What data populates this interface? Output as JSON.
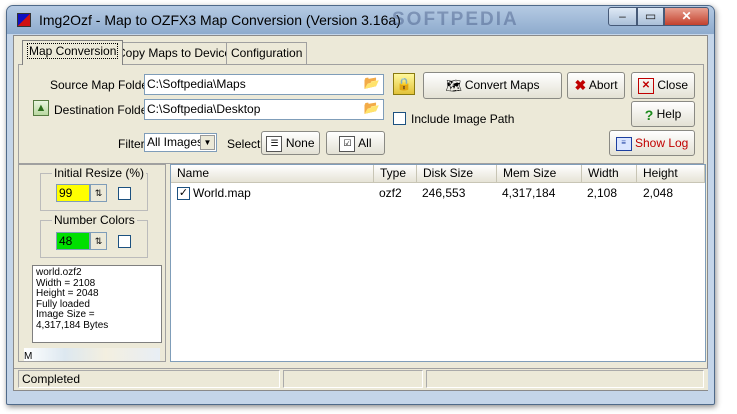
{
  "window": {
    "title": "Img2Ozf - Map to OZFX3 Map Conversion (Version 3.16a)",
    "watermark": "SOFTPEDIA",
    "minimize_label": "‒",
    "maximize_label": "▭",
    "close_label": "✕"
  },
  "tabs": [
    {
      "label": "Map Conversion"
    },
    {
      "label": "Copy Maps to Device"
    },
    {
      "label": "Configuration"
    }
  ],
  "source": {
    "label": "Source Map Folder",
    "value": "C:\\Softpedia\\Maps"
  },
  "destination": {
    "label": "Destination Folder",
    "value": "C:\\Softpedia\\Desktop"
  },
  "filter": {
    "label": "Filter",
    "value": "All Images"
  },
  "select": {
    "label": "Select",
    "none_label": "None",
    "all_label": "All"
  },
  "buttons": {
    "convert": "Convert Maps",
    "abort": "Abort",
    "close": "Close",
    "help": "Help",
    "show_log": "Show Log"
  },
  "include_image_path": {
    "label": "Include Image Path",
    "checked": false
  },
  "initial_resize": {
    "label": "Initial Resize (%)",
    "value": "99",
    "color": "#ffff00"
  },
  "number_colors": {
    "label": "Number Colors",
    "value": "48",
    "color": "#00e000"
  },
  "info_lines": [
    "world.ozf2",
    "Width = 2108",
    "Height = 2048",
    "Fully loaded",
    "Image Size =",
    "4,317,184 Bytes"
  ],
  "map_label": "M",
  "list": {
    "columns": [
      "Name",
      "Type",
      "Disk Size",
      "Mem Size",
      "Width",
      "Height"
    ],
    "rows": [
      {
        "name": "World.map",
        "checked": true,
        "type": "ozf2",
        "disk_size": "246,553",
        "mem_size": "4,317,184",
        "width": "2,108",
        "height": "2,048"
      }
    ]
  },
  "status": {
    "text": "Completed"
  },
  "colors": {
    "show_log_text": "#c00000",
    "accent": "#316ac5"
  }
}
